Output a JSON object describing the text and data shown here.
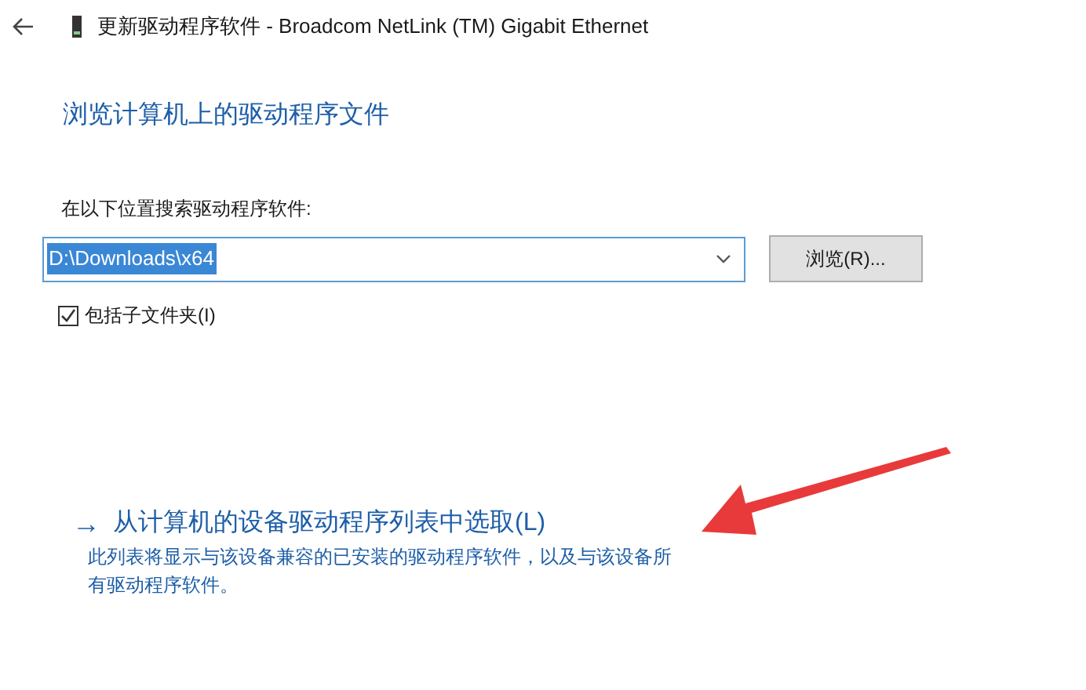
{
  "window": {
    "title": "更新驱动程序软件 - Broadcom NetLink (TM) Gigabit Ethernet"
  },
  "heading": "浏览计算机上的驱动程序文件",
  "search_label": "在以下位置搜索驱动程序软件:",
  "path_field": {
    "value": "D:\\Downloads\\x64"
  },
  "browse_button": "浏览(R)...",
  "include_subfolders": {
    "label": "包括子文件夹(I)",
    "checked": true
  },
  "pick_link": {
    "arrow": "→",
    "label": "从计算机的设备驱动程序列表中选取(L)",
    "description": "此列表将显示与该设备兼容的已安装的驱动程序软件，以及与该设备所有驱动程序软件。"
  }
}
